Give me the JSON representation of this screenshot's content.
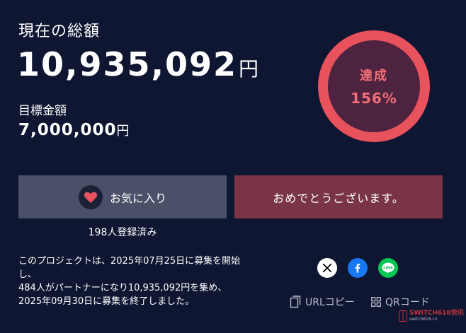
{
  "summary": {
    "total_label": "現在の総額",
    "total_amount": "10,935,092",
    "total_unit": "円",
    "goal_label": "目標金額",
    "goal_amount": "7,000,000",
    "goal_unit": "円"
  },
  "achievement": {
    "label": "達成",
    "percent_text": "156%",
    "percent_value": 156
  },
  "actions": {
    "favorite_label": "お気に入り",
    "favorite_count": "198人登録済み",
    "congrats_label": "おめでとうございます。"
  },
  "description": {
    "lines": [
      "このプロジェクトは、2025年07月25日に募集を開始",
      "し、",
      "484人がパートナーになり10,935,092円を集め、",
      "2025年09月30日に募集を終了しました。"
    ]
  },
  "share": {
    "x_icon": "x-logo-icon",
    "facebook_icon": "facebook-icon",
    "line_icon": "line-icon",
    "url_copy_label": "URLコピー",
    "qr_label": "QRコード"
  },
  "watermark": {
    "text": "SWITCH618资讯",
    "sub": "switch618.cn"
  },
  "colors": {
    "background": "#0e1631",
    "accent": "#e8525c",
    "ring_fill": "#4d2340",
    "favorite_button": "#4a5067",
    "congrats_button": "#7a3447"
  }
}
